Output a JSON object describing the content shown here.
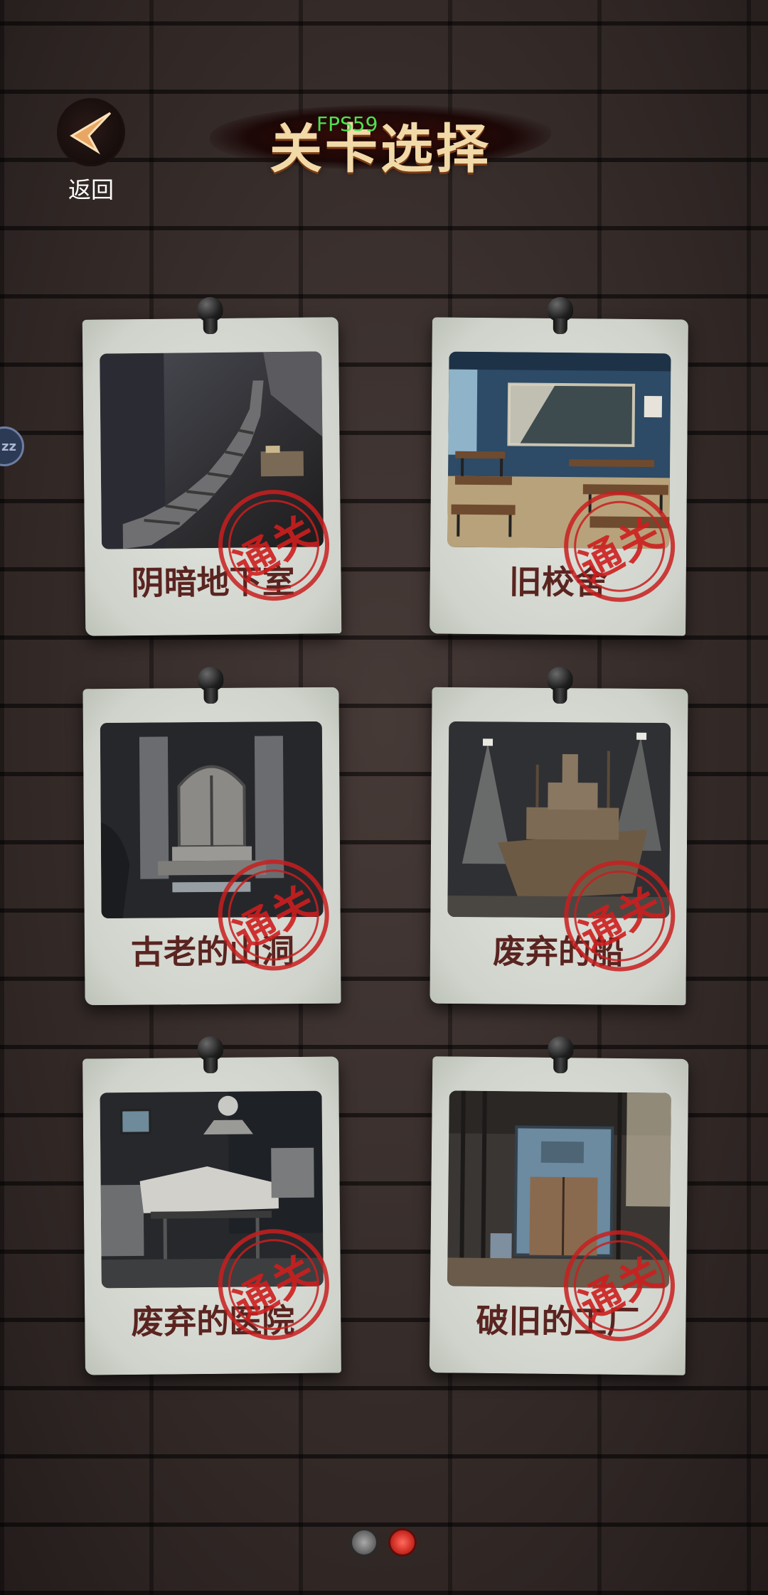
{
  "header": {
    "back_label": "返回",
    "title": "关卡选择",
    "fps": "FPS59",
    "side_tab": "zz"
  },
  "levels": [
    {
      "title": "阴暗地下室",
      "stamp": "通关"
    },
    {
      "title": "旧校舍",
      "stamp": "通关"
    },
    {
      "title": "古老的山洞",
      "stamp": "通关"
    },
    {
      "title": "废弃的船",
      "stamp": "通关"
    },
    {
      "title": "废弃的医院",
      "stamp": "通关"
    },
    {
      "title": "破旧的工厂",
      "stamp": "通关"
    }
  ],
  "pager": {
    "pages": 2,
    "current": 2
  },
  "colors": {
    "wall": "#3a302e",
    "card": "#d9ddd6",
    "title_text": "#f2d9a8",
    "card_title": "#5a2420",
    "stamp_red": "#c81e1e",
    "fps_green": "#4fe04f"
  }
}
